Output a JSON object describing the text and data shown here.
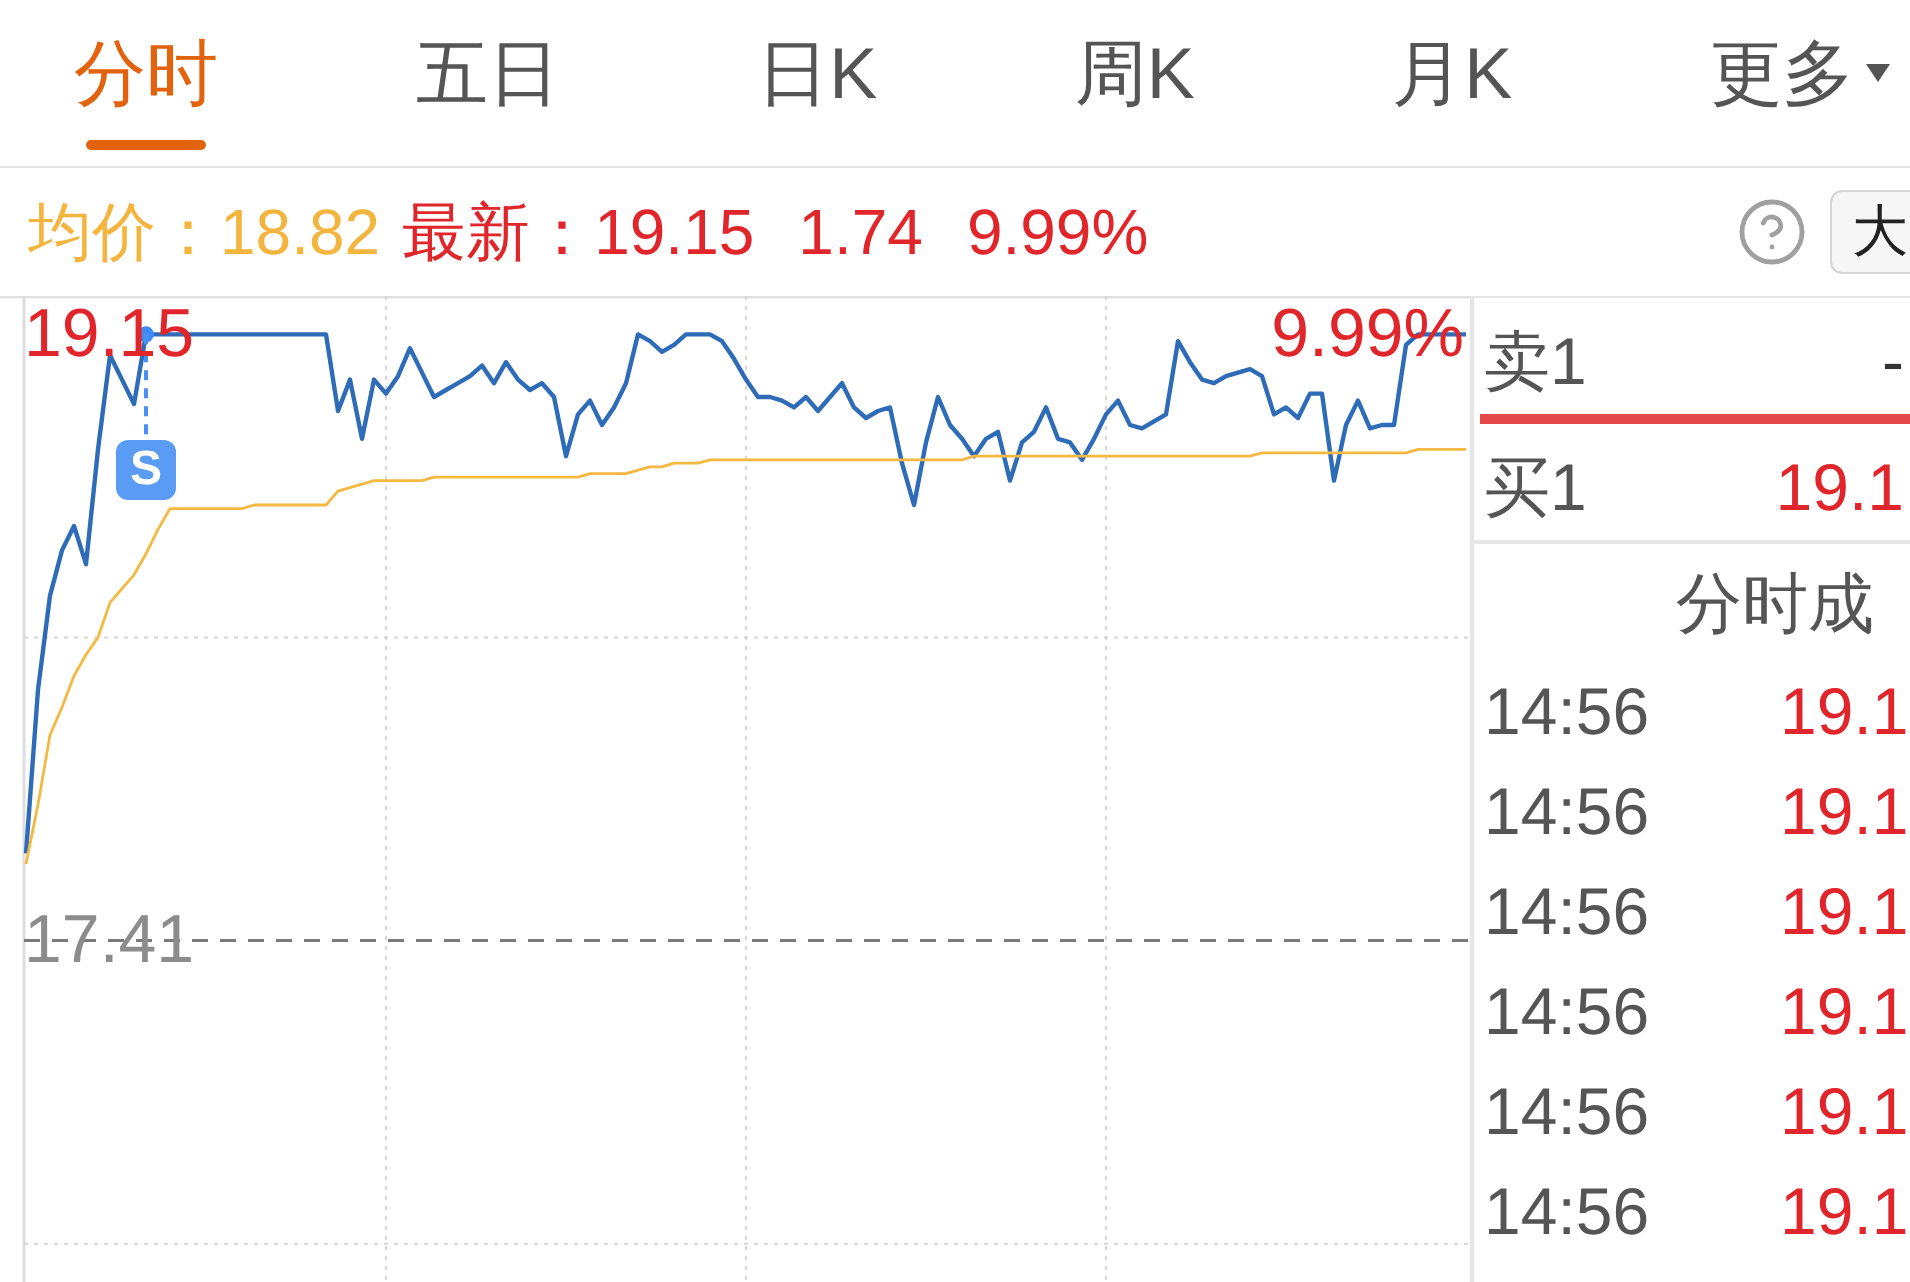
{
  "tabs": [
    {
      "label": "分时",
      "selected": true,
      "menu": false
    },
    {
      "label": "五日",
      "selected": false,
      "menu": false
    },
    {
      "label": "日K",
      "selected": false,
      "menu": false
    },
    {
      "label": "周K",
      "selected": false,
      "menu": false
    },
    {
      "label": "月K",
      "selected": false,
      "menu": false
    },
    {
      "label": "更多",
      "selected": false,
      "menu": true
    }
  ],
  "quote": {
    "avg_label": "均价：",
    "avg_value": "18.82",
    "latest_label": "最新：",
    "latest_value": "19.15",
    "change": "1.74",
    "change_percent": "9.99%"
  },
  "toolbar": {
    "size_button": "大"
  },
  "chart": {
    "right_label": "9.99%",
    "marker_label": "S",
    "chart_data": {
      "type": "line",
      "categories": [
        null,
        null,
        null,
        null,
        null,
        null,
        null,
        null,
        null,
        null,
        null,
        null,
        null,
        null,
        null,
        null,
        null,
        null,
        null,
        null,
        null,
        null,
        null,
        null,
        null,
        null,
        null,
        null,
        null,
        null,
        null,
        null,
        null,
        null,
        null,
        null,
        null,
        null,
        null,
        null,
        null,
        null,
        null,
        null,
        null,
        null,
        null,
        null,
        null,
        null,
        null,
        null,
        null,
        null,
        null,
        null,
        null,
        null,
        null,
        null,
        null,
        null,
        null,
        null,
        null,
        null,
        null,
        null,
        null,
        null,
        null,
        null,
        null,
        null,
        null,
        null,
        null,
        null,
        null,
        null,
        null,
        null,
        null,
        null,
        null,
        null,
        null,
        null,
        null,
        null,
        null,
        null,
        null,
        null,
        null,
        null,
        null,
        null,
        null,
        null,
        null,
        null,
        null,
        null,
        null,
        null,
        null,
        null,
        null,
        null,
        null,
        null,
        null,
        null,
        null,
        null,
        null,
        null,
        null,
        null,
        null
      ],
      "ylim": [
        16.43,
        19.26
      ],
      "yticks": [
        {
          "value": 19.15,
          "label": "19.15"
        },
        {
          "value": 17.41,
          "label": "17.41"
        }
      ],
      "grid": true,
      "ref_lines": [
        {
          "axis": "y",
          "value": 17.41
        }
      ],
      "series": [
        {
          "color": "#2f6cb8",
          "values": [
            17.66,
            18.13,
            18.4,
            18.53,
            18.6,
            18.49,
            18.82,
            19.09,
            19.02,
            18.95,
            19.15,
            19.15,
            19.15,
            19.15,
            19.15,
            19.15,
            19.15,
            19.15,
            19.15,
            19.15,
            19.15,
            19.15,
            19.15,
            19.15,
            19.15,
            19.15,
            18.93,
            19.02,
            18.85,
            19.02,
            18.98,
            19.03,
            19.11,
            19.04,
            18.97,
            18.99,
            19.01,
            19.03,
            19.06,
            19.01,
            19.07,
            19.02,
            18.99,
            19.01,
            18.97,
            18.8,
            18.92,
            18.96,
            18.89,
            18.94,
            19.01,
            19.15,
            19.13,
            19.1,
            19.12,
            19.15,
            19.15,
            19.15,
            19.13,
            19.08,
            19.02,
            18.97,
            18.97,
            18.96,
            18.94,
            18.97,
            18.93,
            18.97,
            19.01,
            18.94,
            18.91,
            18.93,
            18.94,
            18.78,
            18.66,
            18.84,
            18.97,
            18.89,
            18.85,
            18.8,
            18.85,
            18.87,
            18.73,
            18.84,
            18.87,
            18.94,
            18.85,
            18.84,
            18.79,
            18.85,
            18.92,
            18.96,
            18.89,
            18.88,
            18.9,
            18.92,
            19.13,
            19.07,
            19.02,
            19.01,
            19.03,
            19.04,
            19.05,
            19.03,
            18.92,
            18.94,
            18.91,
            18.98,
            18.98,
            18.73,
            18.89,
            18.96,
            18.88,
            18.89,
            18.89,
            19.12,
            19.15,
            19.15,
            19.15,
            19.15,
            19.15
          ]
        },
        {
          "color": "#f5b840",
          "values": [
            17.63,
            17.8,
            18.0,
            18.08,
            18.17,
            18.23,
            18.28,
            18.38,
            18.42,
            18.46,
            18.52,
            18.59,
            18.65,
            18.65,
            18.65,
            18.65,
            18.65,
            18.65,
            18.65,
            18.66,
            18.66,
            18.66,
            18.66,
            18.66,
            18.66,
            18.66,
            18.7,
            18.71,
            18.72,
            18.73,
            18.73,
            18.73,
            18.73,
            18.73,
            18.74,
            18.74,
            18.74,
            18.74,
            18.74,
            18.74,
            18.74,
            18.74,
            18.74,
            18.74,
            18.74,
            18.74,
            18.74,
            18.75,
            18.75,
            18.75,
            18.75,
            18.76,
            18.77,
            18.77,
            18.78,
            18.78,
            18.78,
            18.79,
            18.79,
            18.79,
            18.79,
            18.79,
            18.79,
            18.79,
            18.79,
            18.79,
            18.79,
            18.79,
            18.79,
            18.79,
            18.79,
            18.79,
            18.79,
            18.79,
            18.79,
            18.79,
            18.79,
            18.79,
            18.79,
            18.8,
            18.8,
            18.8,
            18.8,
            18.8,
            18.8,
            18.8,
            18.8,
            18.8,
            18.8,
            18.8,
            18.8,
            18.8,
            18.8,
            18.8,
            18.8,
            18.8,
            18.8,
            18.8,
            18.8,
            18.8,
            18.8,
            18.8,
            18.8,
            18.81,
            18.81,
            18.81,
            18.81,
            18.81,
            18.81,
            18.81,
            18.81,
            18.81,
            18.81,
            18.81,
            18.81,
            18.81,
            18.82,
            18.82,
            18.82,
            18.82,
            18.82
          ]
        }
      ]
    }
  },
  "order_book": [
    {
      "label": "卖1",
      "price": "-",
      "color": "#333333"
    },
    {
      "label": "买1",
      "price": "19.1",
      "color": "#e0262b"
    }
  ],
  "trades": {
    "title": "分时成",
    "rows": [
      {
        "time": "14:56",
        "price": "19.1"
      },
      {
        "time": "14:56",
        "price": "19.1"
      },
      {
        "time": "14:56",
        "price": "19.1"
      },
      {
        "time": "14:56",
        "price": "19.1"
      },
      {
        "time": "14:56",
        "price": "19.1"
      },
      {
        "time": "14:56",
        "price": "19.1"
      }
    ]
  }
}
